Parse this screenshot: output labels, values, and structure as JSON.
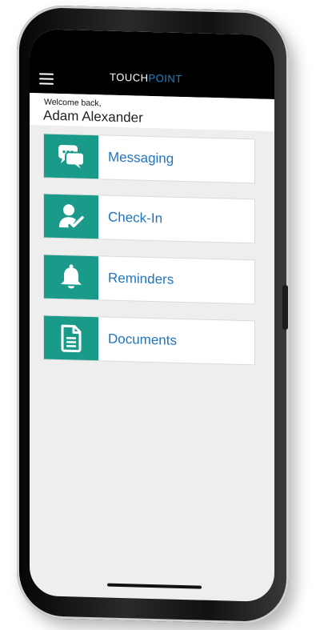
{
  "app": {
    "brand_part1": "TOUCH",
    "brand_part2": "POINT",
    "accent_color": "#1a9b8a",
    "brand_color": "#1f86c9"
  },
  "welcome": {
    "greeting": "Welcome back,",
    "user_name": "Adam Alexander"
  },
  "menu": {
    "icon": "hamburger-menu-icon"
  },
  "tiles": [
    {
      "label": "Messaging",
      "icon": "chat-bubbles-icon"
    },
    {
      "label": "Check-In",
      "icon": "user-check-icon"
    },
    {
      "label": "Reminders",
      "icon": "bell-icon"
    },
    {
      "label": "Documents",
      "icon": "document-icon"
    }
  ]
}
